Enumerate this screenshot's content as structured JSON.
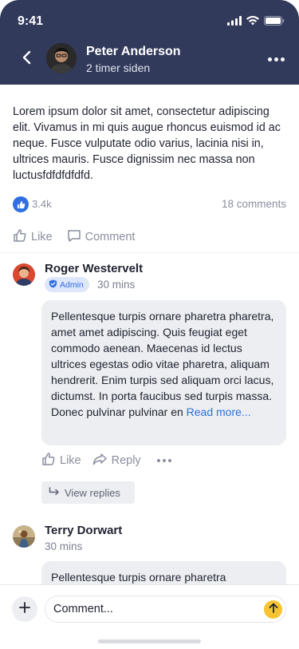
{
  "status_bar": {
    "time": "9:41",
    "icons": [
      "signal-icon",
      "wifi-icon",
      "battery-icon"
    ]
  },
  "header": {
    "back_icon": "chevron-left-icon",
    "user_name": "Peter Anderson",
    "time": "2 timer siden",
    "more_icon": "more-horizontal-icon",
    "background": "#323a5b"
  },
  "post": {
    "text": "Lorem ipsum dolor sit amet, consectetur adipiscing elit. Vivamus in mi quis augue rhoncus euismod id ac neque. Fusce vulputate odio varius, lacinia nisi in, ultrices mauris. Fusce dignissim nec massa non luctusfdfdfdfdfd.",
    "like_count": "3.4k",
    "comment_count": "18 comments",
    "actions": {
      "like": "Like",
      "comment": "Comment"
    }
  },
  "comments": [
    {
      "author": "Roger Westervelt",
      "badge": "Admin",
      "time": "30 mins",
      "text": "Pellentesque turpis ornare pharetra pharetra, amet amet adipiscing. Quis feugiat eget commodo aenean. Maecenas id lectus ultrices egestas odio vitae pharetra, aliquam hendrerit. Enim turpis sed aliquam orci lacus, dictumst. In porta faucibus sed turpis massa. Donec pulvinar pulvinar en",
      "read_more": "Read more...",
      "actions": {
        "like": "Like",
        "reply": "Reply"
      },
      "view_replies": "View replies"
    },
    {
      "author": "Terry Dorwart",
      "time": "30 mins",
      "text": "Pellentesque turpis ornare pharetra"
    }
  ],
  "composer": {
    "placeholder": "Comment...",
    "add_icon": "plus-icon",
    "send_icon": "arrow-up-icon",
    "send_color": "#f7c431"
  },
  "colors": {
    "accent": "#2f6fe0",
    "muted": "#8a8f9e",
    "bubble": "#eceef1"
  }
}
